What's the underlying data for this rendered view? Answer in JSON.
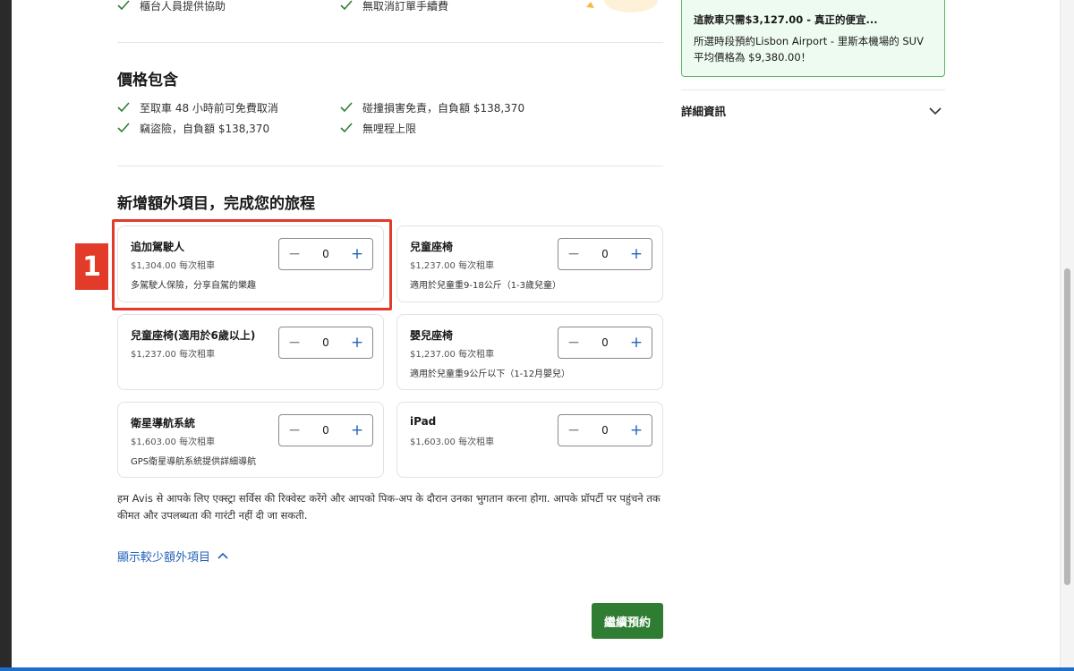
{
  "top_features": {
    "left": "櫃台人員提供協助",
    "right": "無取消訂單手續費"
  },
  "price_includes": {
    "title": "價格包含",
    "items": [
      "至取車 48 小時前可免費取消",
      "碰撞損害免責，自負額 $138,370",
      "竊盜險，自負額 $138,370",
      "無哩程上限"
    ]
  },
  "extras": {
    "title": "新增額外項目，完成您的旅程",
    "items": [
      {
        "title": "追加駕駛人",
        "price": "$1,304.00 每次租車",
        "desc": "多駕駛人保險，分享自駕的樂趣",
        "qty": "0"
      },
      {
        "title": "兒童座椅",
        "price": "$1,237.00 每次租車",
        "desc": "適用於兒童重9-18公斤（1-3歲兒童）",
        "qty": "0"
      },
      {
        "title": "兒童座椅(適用於6歲以上)",
        "price": "$1,237.00 每次租車",
        "desc": "",
        "qty": "0"
      },
      {
        "title": "嬰兒座椅",
        "price": "$1,237.00 每次租車",
        "desc": "適用於兒童重9公斤以下（1-12月嬰兒）",
        "qty": "0"
      },
      {
        "title": "衛星導航系統",
        "price": "$1,603.00 每次租車",
        "desc": "GPS衛星導航系統提供詳細導航",
        "qty": "0"
      },
      {
        "title": "iPad",
        "price": "$1,603.00 每次租車",
        "desc": "",
        "qty": "0"
      }
    ],
    "stepper_minus": "−",
    "stepper_plus": "+"
  },
  "note": {
    "line1": "हम Avis से आपके लिए एक्स्ट्रा सर्विस की रिक्वेस्ट करेंगे और आपको पिक-अप के दौरान उनका भुगतान करना होगा. आपके प्रॉपर्टी पर पहुंचने तक",
    "line2": "कीमत और उपलब्धता की गारंटी नहीं दी जा सकती."
  },
  "show_less_label": "顯示較少額外項目",
  "continue_label": "繼續預約",
  "annotation_marker": "1",
  "sidebar": {
    "promo_title": "這款車只需$3,127.00 - 真正的便宜...",
    "promo_line1": "所選時段預約Lisbon Airport - 里斯本機場的 SUV",
    "promo_line2": "平均價格為 $9,380.00！",
    "details_label": "詳細資訊"
  },
  "colors": {
    "accent_green": "#2e7d32",
    "check_green": "#2e7d32",
    "link_blue": "#2563b8",
    "highlight_red": "#e23b2a",
    "promo_bg": "#eefbf0"
  },
  "icons": {
    "check": "check-icon",
    "minus": "minus-icon",
    "plus": "plus-icon",
    "chevron_up": "chevron-up-icon",
    "chevron_down": "chevron-down-icon"
  }
}
